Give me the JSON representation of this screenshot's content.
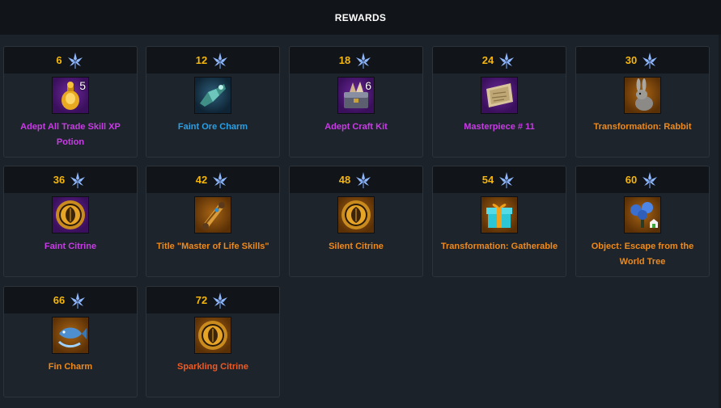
{
  "header": {
    "title": "REWARDS"
  },
  "rewards": [
    {
      "level": "6",
      "name": "Adept All Trade Skill XP Potion",
      "quantity": "5",
      "icon": "potion-icon",
      "rarity": "purple"
    },
    {
      "level": "12",
      "name": "Faint Ore Charm",
      "quantity": "",
      "icon": "ore-charm-icon",
      "rarity": "blue"
    },
    {
      "level": "18",
      "name": "Adept Craft Kit",
      "quantity": "6",
      "icon": "craft-kit-icon",
      "rarity": "purple"
    },
    {
      "level": "24",
      "name": "Masterpiece # 11",
      "quantity": "",
      "icon": "masterpiece-map-icon",
      "rarity": "purple"
    },
    {
      "level": "30",
      "name": "Transformation: Rabbit",
      "quantity": "",
      "icon": "rabbit-icon",
      "rarity": "orange"
    },
    {
      "level": "36",
      "name": "Faint Citrine",
      "quantity": "",
      "icon": "citrine-gem-icon",
      "rarity": "purple"
    },
    {
      "level": "42",
      "name": "Title \"Master of Life Skills\"",
      "quantity": "",
      "icon": "scroll-icon",
      "rarity": "orange"
    },
    {
      "level": "48",
      "name": "Silent Citrine",
      "quantity": "",
      "icon": "citrine-gem-icon",
      "rarity": "orange"
    },
    {
      "level": "54",
      "name": "Transformation: Gatherable",
      "quantity": "",
      "icon": "gift-box-icon",
      "rarity": "orange"
    },
    {
      "level": "60",
      "name": "Object: Escape from the World Tree",
      "quantity": "",
      "icon": "world-tree-icon",
      "rarity": "orange"
    },
    {
      "level": "66",
      "name": "Fin Charm",
      "quantity": "",
      "icon": "fish-charm-icon",
      "rarity": "orange"
    },
    {
      "level": "72",
      "name": "Sparkling Citrine",
      "quantity": "",
      "icon": "citrine-gem-icon",
      "rarity": "red"
    }
  ],
  "colors": {
    "level_gold": "#f5b50a",
    "purple": "#c83ce6",
    "blue": "#2aa0e6",
    "orange": "#ee8a1c",
    "red": "#f05a22",
    "leaf": "#8fb8ff"
  }
}
